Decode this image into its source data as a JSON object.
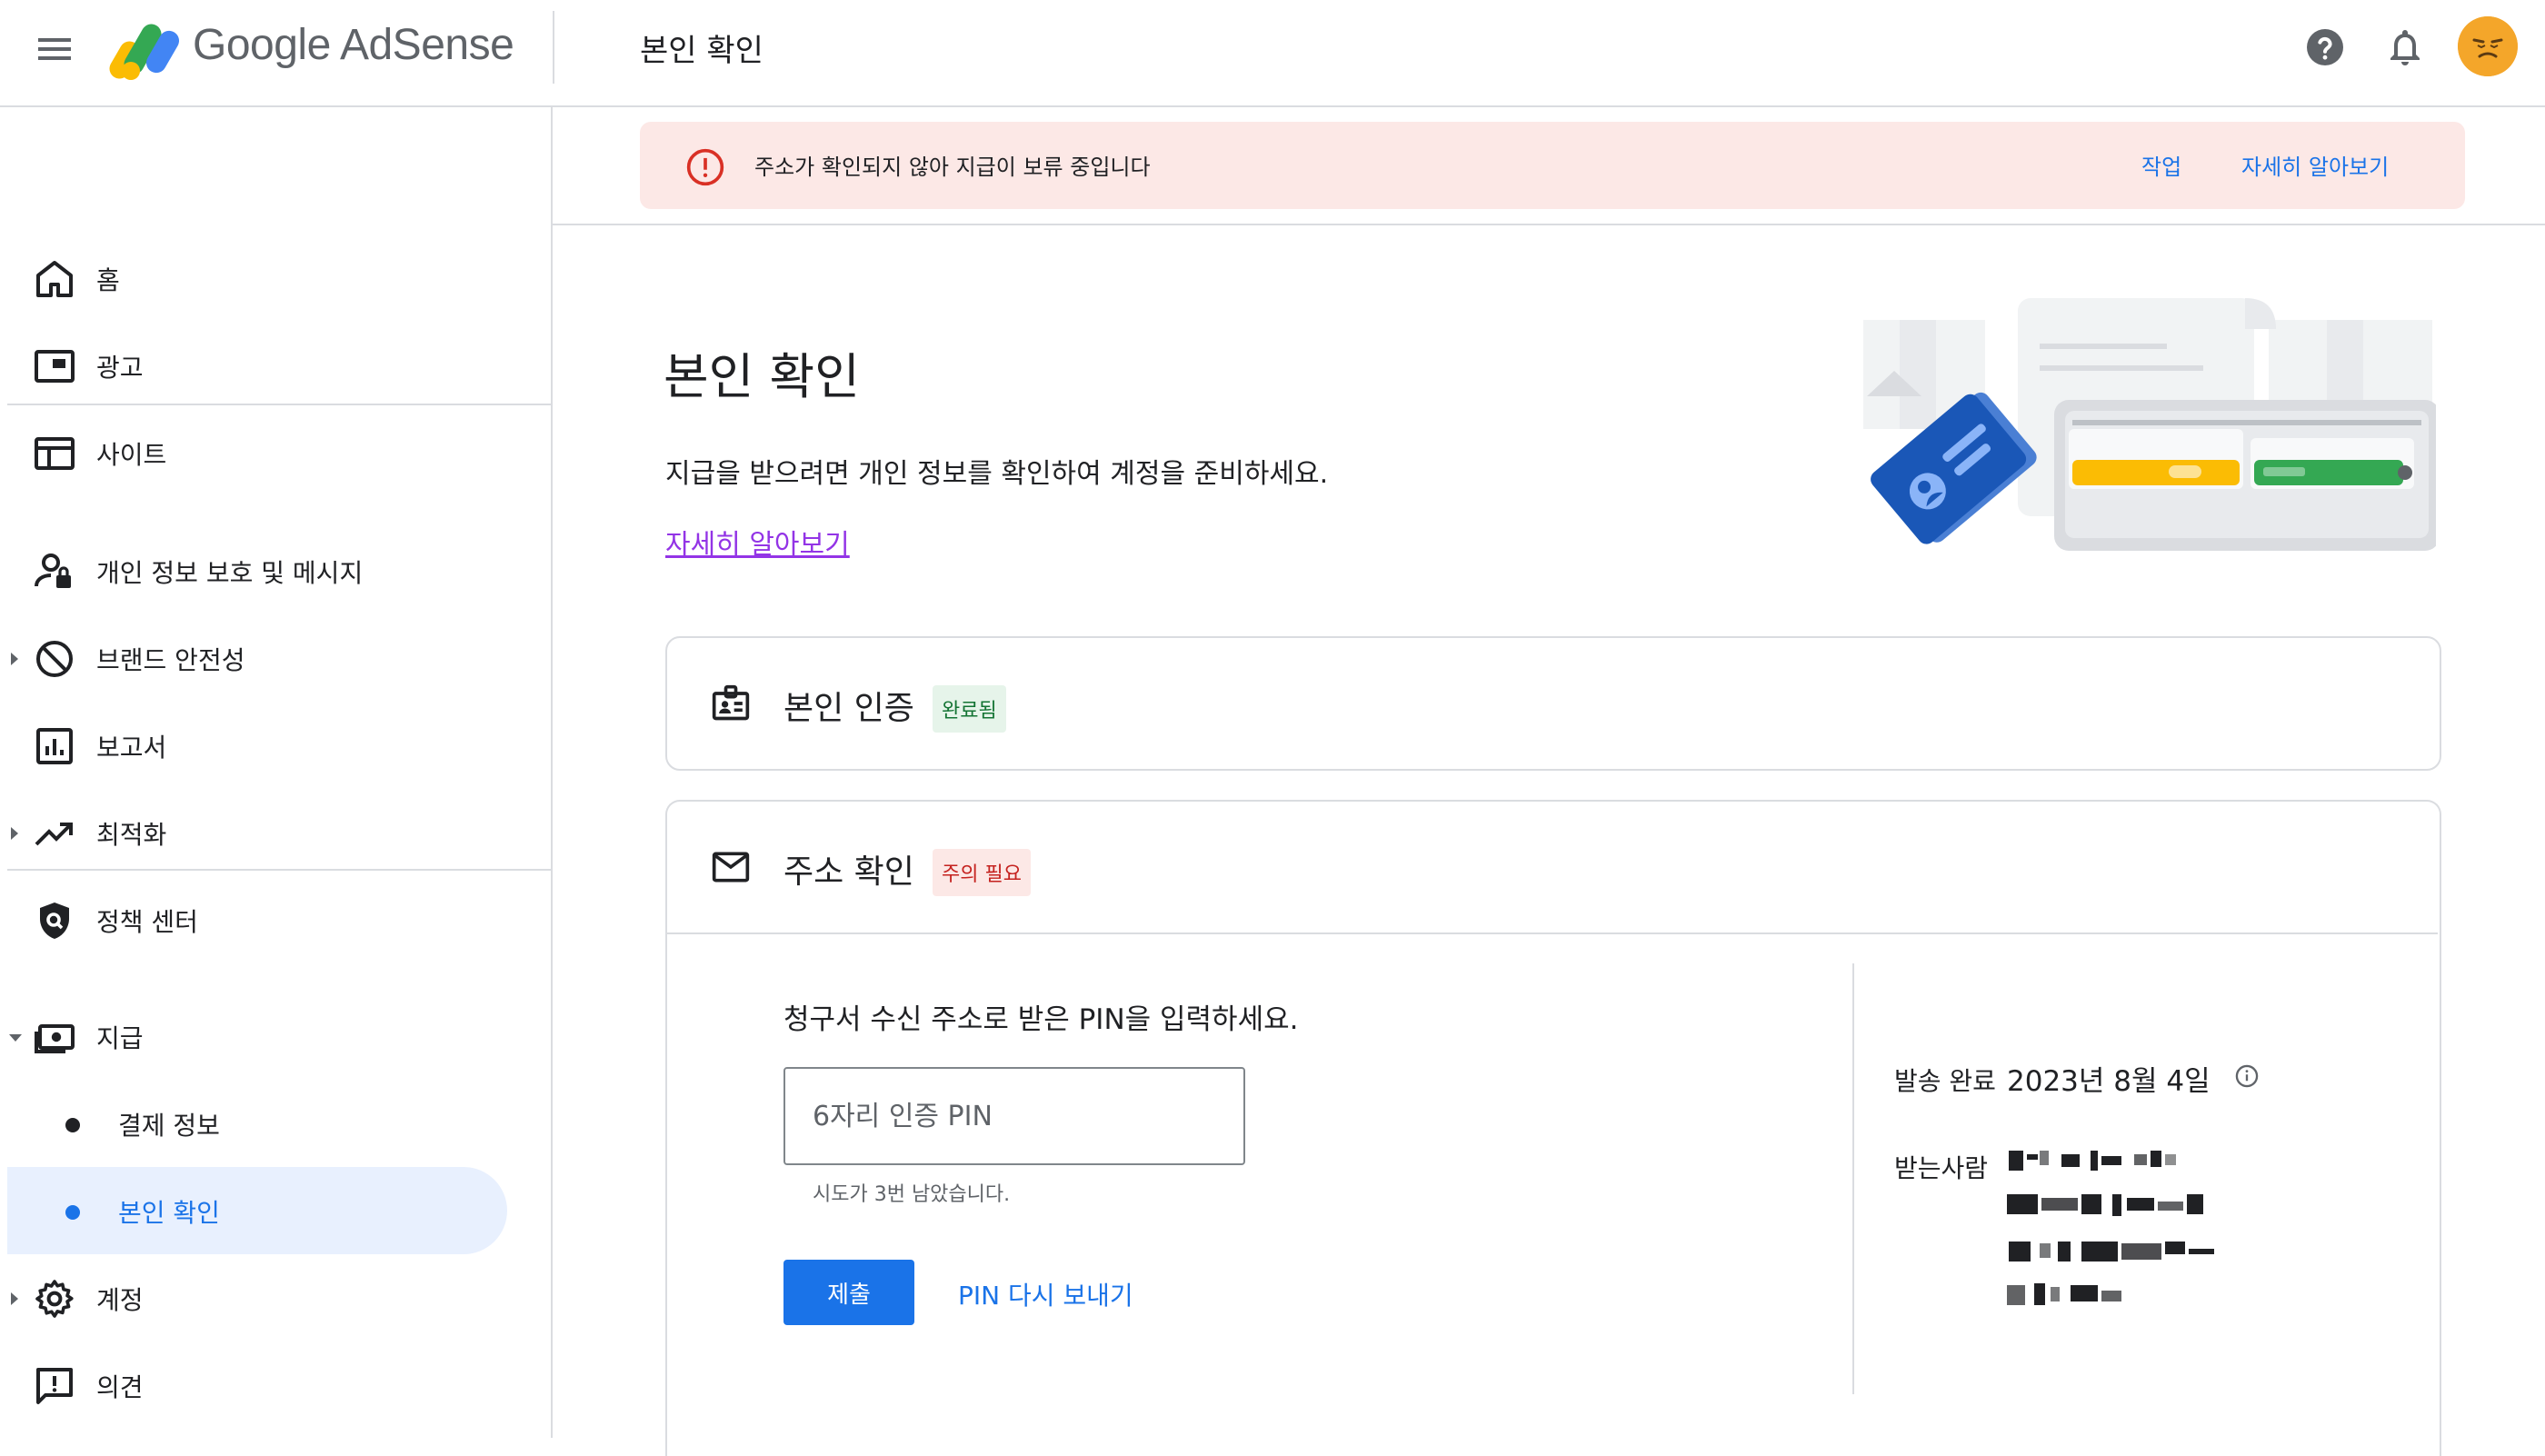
{
  "app": {
    "brand": "Google AdSense",
    "header_title": "본인 확인"
  },
  "sidebar": {
    "items": [
      {
        "label": "홈",
        "icon": "home-icon"
      },
      {
        "label": "광고",
        "icon": "ads-icon"
      },
      {
        "label": "사이트",
        "icon": "sites-icon"
      },
      {
        "label": "개인 정보 보호 및 메시지",
        "icon": "privacy-icon"
      },
      {
        "label": "브랜드 안전성",
        "icon": "block-icon"
      },
      {
        "label": "보고서",
        "icon": "reports-icon"
      },
      {
        "label": "최적화",
        "icon": "trending-icon"
      },
      {
        "label": "정책 센터",
        "icon": "policy-shield-icon"
      },
      {
        "label": "지급",
        "icon": "payments-icon"
      },
      {
        "label": "결제 정보",
        "icon": "dot"
      },
      {
        "label": "본인 확인",
        "icon": "dot"
      },
      {
        "label": "계정",
        "icon": "gear-icon"
      },
      {
        "label": "의견",
        "icon": "feedback-icon"
      }
    ],
    "selected": "본인 확인"
  },
  "alert": {
    "message": "주소가 확인되지 않아 지급이 보류 중입니다",
    "action": "작업",
    "learn_more": "자세히 알아보기"
  },
  "page": {
    "title": "본인 확인",
    "subtitle": "지급을 받으려면 개인 정보를 확인하여 계정을 준비하세요.",
    "learn_more": "자세히 알아보기"
  },
  "identity_card": {
    "title": "본인 인증",
    "status": "완료됨"
  },
  "address_card": {
    "title": "주소 확인",
    "status": "주의 필요",
    "pin_prompt": "청구서 수신 주소로 받은 PIN을 입력하세요.",
    "pin_placeholder": "6자리 인증 PIN",
    "attempts": "시도가 3번 남았습니다.",
    "submit": "제출",
    "resend": "PIN 다시 보내기",
    "sent_label": "발송 완료",
    "sent_date": "2023년 8월 4일",
    "recipient_label": "받는사람"
  },
  "colors": {
    "accent": "#1a73e8",
    "alert_bg": "#fce8e6",
    "alert_icon": "#d93025",
    "success_chip_bg": "#e6f4ea",
    "success_chip_text": "#137333",
    "warn_chip_text": "#c5221f",
    "selected_nav_bg": "#e8f0fe",
    "link_visited": "#9334e6"
  }
}
